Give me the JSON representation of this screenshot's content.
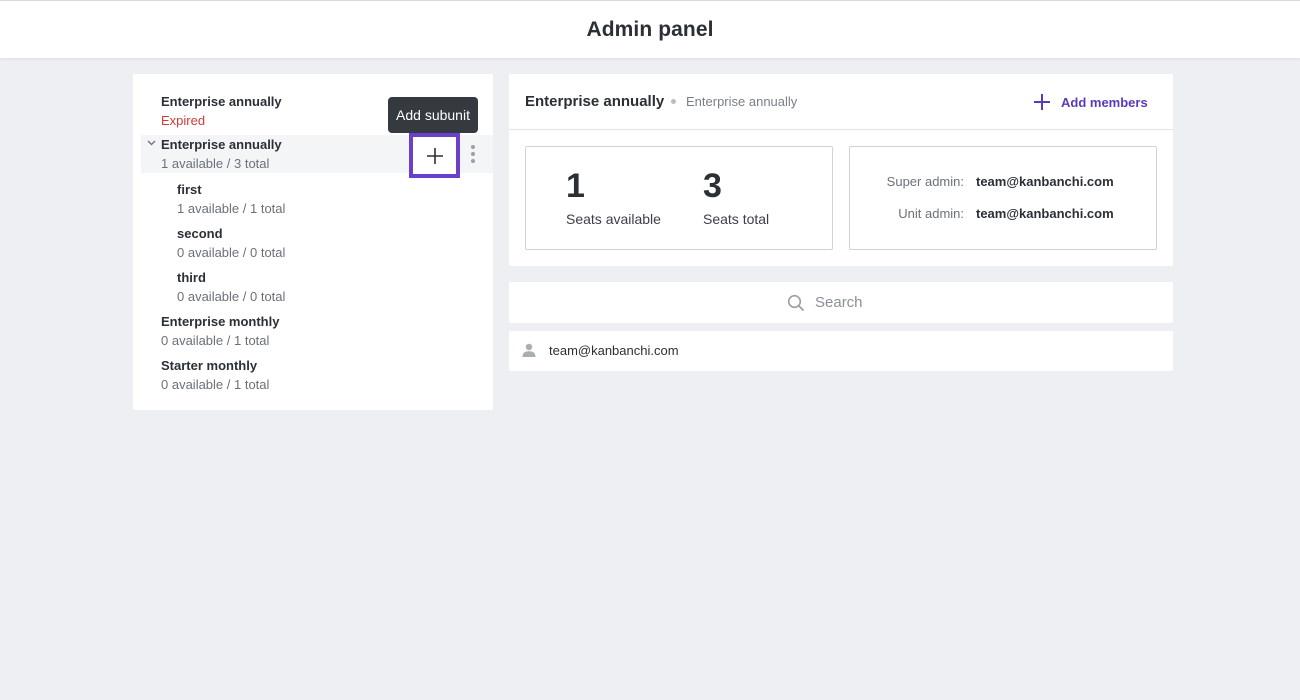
{
  "header": {
    "title": "Admin panel"
  },
  "units": [
    {
      "name": "Enterprise annually",
      "status": "Expired"
    },
    {
      "name": "Enterprise annually",
      "status": "1 available / 3 total"
    },
    {
      "name": "first",
      "status": "1 available / 1 total"
    },
    {
      "name": "second",
      "status": "0 available / 0 total"
    },
    {
      "name": "third",
      "status": "0 available / 0 total"
    },
    {
      "name": "Enterprise monthly",
      "status": "0 available / 1 total"
    },
    {
      "name": "Starter monthly",
      "status": "0 available / 1 total"
    }
  ],
  "tooltip": {
    "text": "Add subunit"
  },
  "detail": {
    "title": "Enterprise annually",
    "subtitle": "Enterprise annually",
    "add_members_label": "Add members",
    "seats_available_value": "1",
    "seats_available_label": "Seats available",
    "seats_total_value": "3",
    "seats_total_label": "Seats total",
    "super_admin_label": "Super admin:",
    "super_admin_value": "team@kanbanchi.com",
    "unit_admin_label": "Unit admin:",
    "unit_admin_value": "team@kanbanchi.com"
  },
  "search": {
    "placeholder": "Search"
  },
  "members": [
    {
      "email": "team@kanbanchi.com"
    }
  ],
  "colors": {
    "accent": "#6a3fc9",
    "expired": "#d23a3a",
    "link": "#5b3ab8"
  }
}
